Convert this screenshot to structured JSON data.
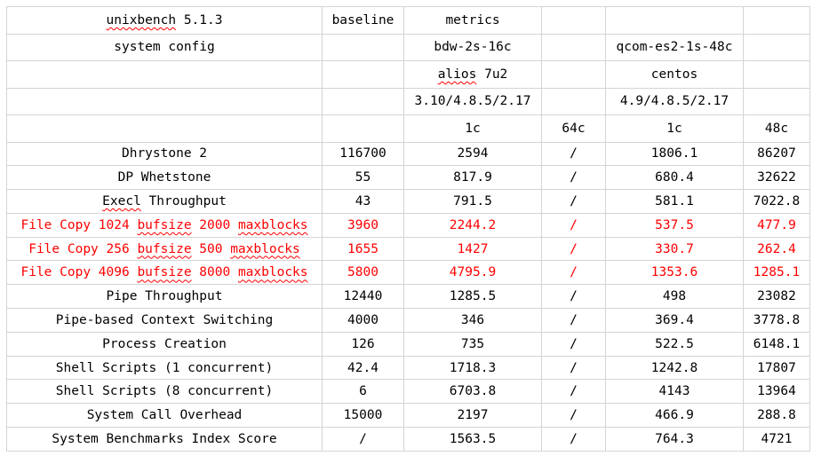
{
  "header": {
    "title_prefix": "unixbench",
    "title_suffix": " 5.1.3",
    "baseline": "baseline",
    "metrics": "metrics",
    "system_config": "system config",
    "machine_a": "bdw-2s-16c",
    "machine_b": "qcom-es2-1s-48c",
    "os_a_prefix": "alios",
    "os_a_suffix": " 7u2",
    "os_b": "centos",
    "kernel_a": "3.10/4.8.5/2.17",
    "kernel_b": "4.9/4.8.5/2.17",
    "cores_a1": "1c",
    "cores_a64": "64c",
    "cores_b1": "1c",
    "cores_b48": "48c"
  },
  "rows": [
    {
      "name_parts": [
        "Dhrystone 2"
      ],
      "baseline": "116700",
      "a1": "2594",
      "a64": "/",
      "b1": "1806.1",
      "b48": "86207"
    },
    {
      "name_parts": [
        "DP Whetstone"
      ],
      "baseline": "55",
      "a1": "817.9",
      "a64": "/",
      "b1": "680.4",
      "b48": "32622"
    },
    {
      "name_parts": [
        "Execl",
        " Throughput"
      ],
      "baseline": "43",
      "a1": "791.5",
      "a64": "/",
      "b1": "581.1",
      "b48": "7022.8"
    },
    {
      "name_parts": [
        "File Copy 1024 ",
        "bufsize",
        " 2000 ",
        "maxblocks"
      ],
      "baseline": "3960",
      "a1": "2244.2",
      "a64": "/",
      "b1": "537.5",
      "b48": "477.9"
    },
    {
      "name_parts": [
        "File Copy 256 ",
        "bufsize",
        " 500 ",
        "maxblocks"
      ],
      "baseline": "1655",
      "a1": "1427",
      "a64": "/",
      "b1": "330.7",
      "b48": "262.4"
    },
    {
      "name_parts": [
        "File Copy 4096 ",
        "bufsize",
        " 8000 ",
        "maxblocks"
      ],
      "baseline": "5800",
      "a1": "4795.9",
      "a64": "/",
      "b1": "1353.6",
      "b48": "1285.1"
    },
    {
      "name_parts": [
        "Pipe Throughput"
      ],
      "baseline": "12440",
      "a1": "1285.5",
      "a64": "/",
      "b1": "498",
      "b48": "23082"
    },
    {
      "name_parts": [
        "Pipe-based Context Switching"
      ],
      "baseline": "4000",
      "a1": "346",
      "a64": "/",
      "b1": "369.4",
      "b48": "3778.8"
    },
    {
      "name_parts": [
        "Process Creation"
      ],
      "baseline": "126",
      "a1": "735",
      "a64": "/",
      "b1": "522.5",
      "b48": "6148.1"
    },
    {
      "name_parts": [
        "Shell Scripts (1 concurrent)"
      ],
      "baseline": "42.4",
      "a1": "1718.3",
      "a64": "/",
      "b1": "1242.8",
      "b48": "17807"
    },
    {
      "name_parts": [
        "Shell Scripts (8 concurrent)"
      ],
      "baseline": "6",
      "a1": "6703.8",
      "a64": "/",
      "b1": "4143",
      "b48": "13964"
    },
    {
      "name_parts": [
        "System Call Overhead"
      ],
      "baseline": "15000",
      "a1": "2197",
      "a64": "/",
      "b1": "466.9",
      "b48": "288.8"
    },
    {
      "name_parts": [
        "System Benchmarks Index Score"
      ],
      "baseline": "/",
      "a1": "1563.5",
      "a64": "/",
      "b1": "764.3",
      "b48": "4721"
    }
  ],
  "colors": {
    "text": "#000000",
    "highlight_text": "#ff0000",
    "spellcheck_underline": "#ff0000",
    "grid": "#d4d4d4"
  }
}
